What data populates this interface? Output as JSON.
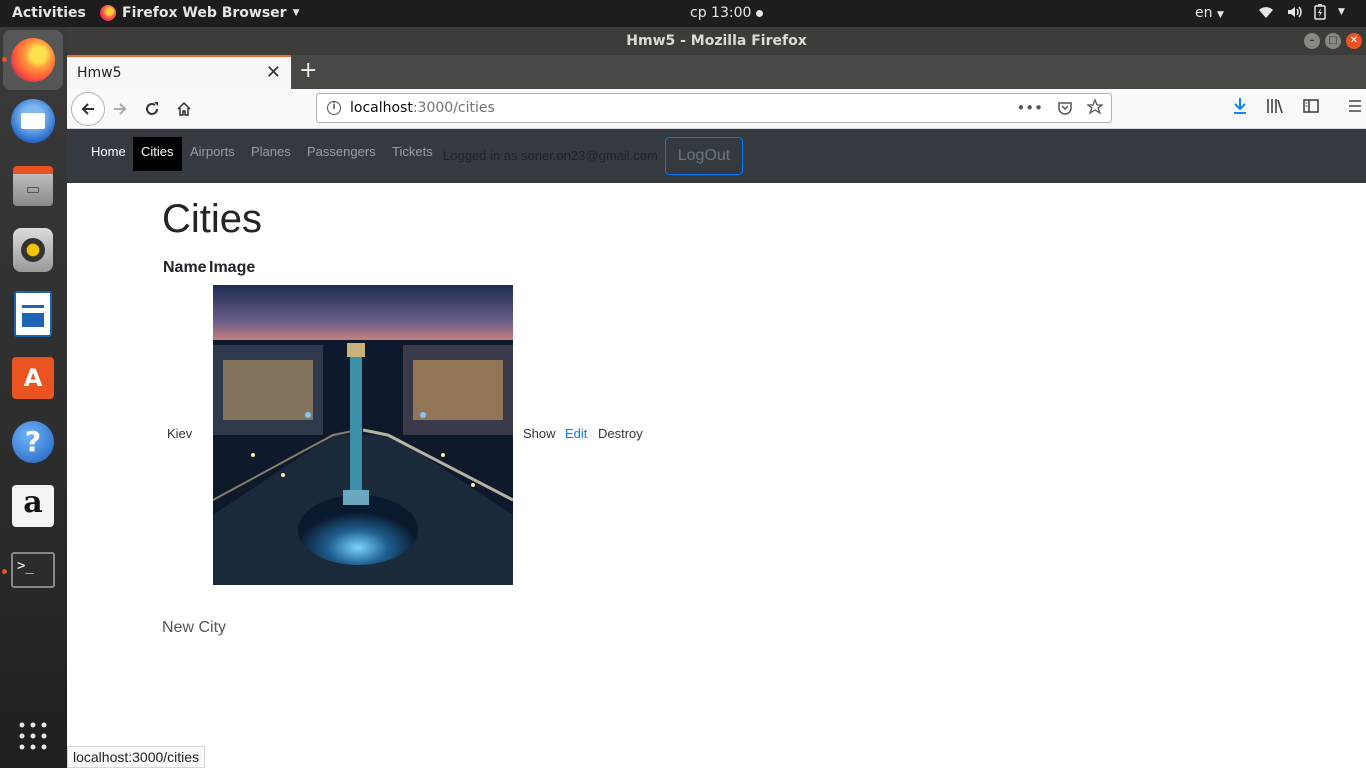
{
  "system": {
    "activities": "Activities",
    "app_name": "Firefox Web Browser",
    "clock": "ср 13:00",
    "lang": "en"
  },
  "window": {
    "title": "Hmw5 - Mozilla Firefox"
  },
  "tab": {
    "title": "Hmw5"
  },
  "urlbar": {
    "host": "localhost",
    "path": ":3000/cities"
  },
  "nav": {
    "items": [
      "Home",
      "Cities",
      "Airports",
      "Planes",
      "Passengers",
      "Tickets"
    ],
    "logged_in": "Logged in as soner.on23@gmail.com",
    "logout": "LogOut"
  },
  "main": {
    "title": "Cities",
    "columns": [
      "Name",
      "Image"
    ],
    "rows": [
      {
        "name": "Kiev",
        "show": "Show",
        "edit": "Edit",
        "destroy": "Destroy"
      }
    ],
    "new_link": "New City"
  },
  "status": {
    "url": "localhost:3000/cities"
  },
  "colors": {
    "navbar_bg": "#343a40",
    "link_blue": "#007bff",
    "accent_orange": "#e95420"
  }
}
